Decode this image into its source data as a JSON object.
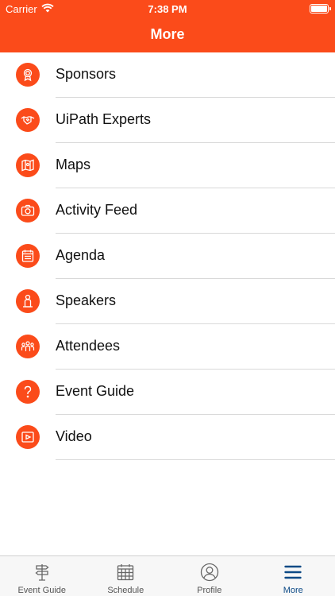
{
  "status_bar": {
    "carrier": "Carrier",
    "time": "7:38 PM"
  },
  "header": {
    "title": "More"
  },
  "colors": {
    "accent": "#fb4b1a",
    "active_tab": "#0d4a86"
  },
  "menu": {
    "items": [
      {
        "label": "Sponsors",
        "icon": "award-ribbon-icon"
      },
      {
        "label": "UiPath Experts",
        "icon": "handshake-icon"
      },
      {
        "label": "Maps",
        "icon": "map-pin-icon"
      },
      {
        "label": "Activity Feed",
        "icon": "camera-icon"
      },
      {
        "label": "Agenda",
        "icon": "calendar-icon"
      },
      {
        "label": "Speakers",
        "icon": "speaker-person-icon"
      },
      {
        "label": "Attendees",
        "icon": "people-group-icon"
      },
      {
        "label": "Event Guide",
        "icon": "question-icon"
      },
      {
        "label": "Video",
        "icon": "play-video-icon"
      }
    ]
  },
  "tabbar": {
    "tabs": [
      {
        "label": "Event Guide",
        "icon": "signpost-icon",
        "active": false
      },
      {
        "label": "Schedule",
        "icon": "calendar-grid-icon",
        "active": false
      },
      {
        "label": "Profile",
        "icon": "profile-circle-icon",
        "active": false
      },
      {
        "label": "More",
        "icon": "hamburger-menu-icon",
        "active": true
      }
    ]
  }
}
